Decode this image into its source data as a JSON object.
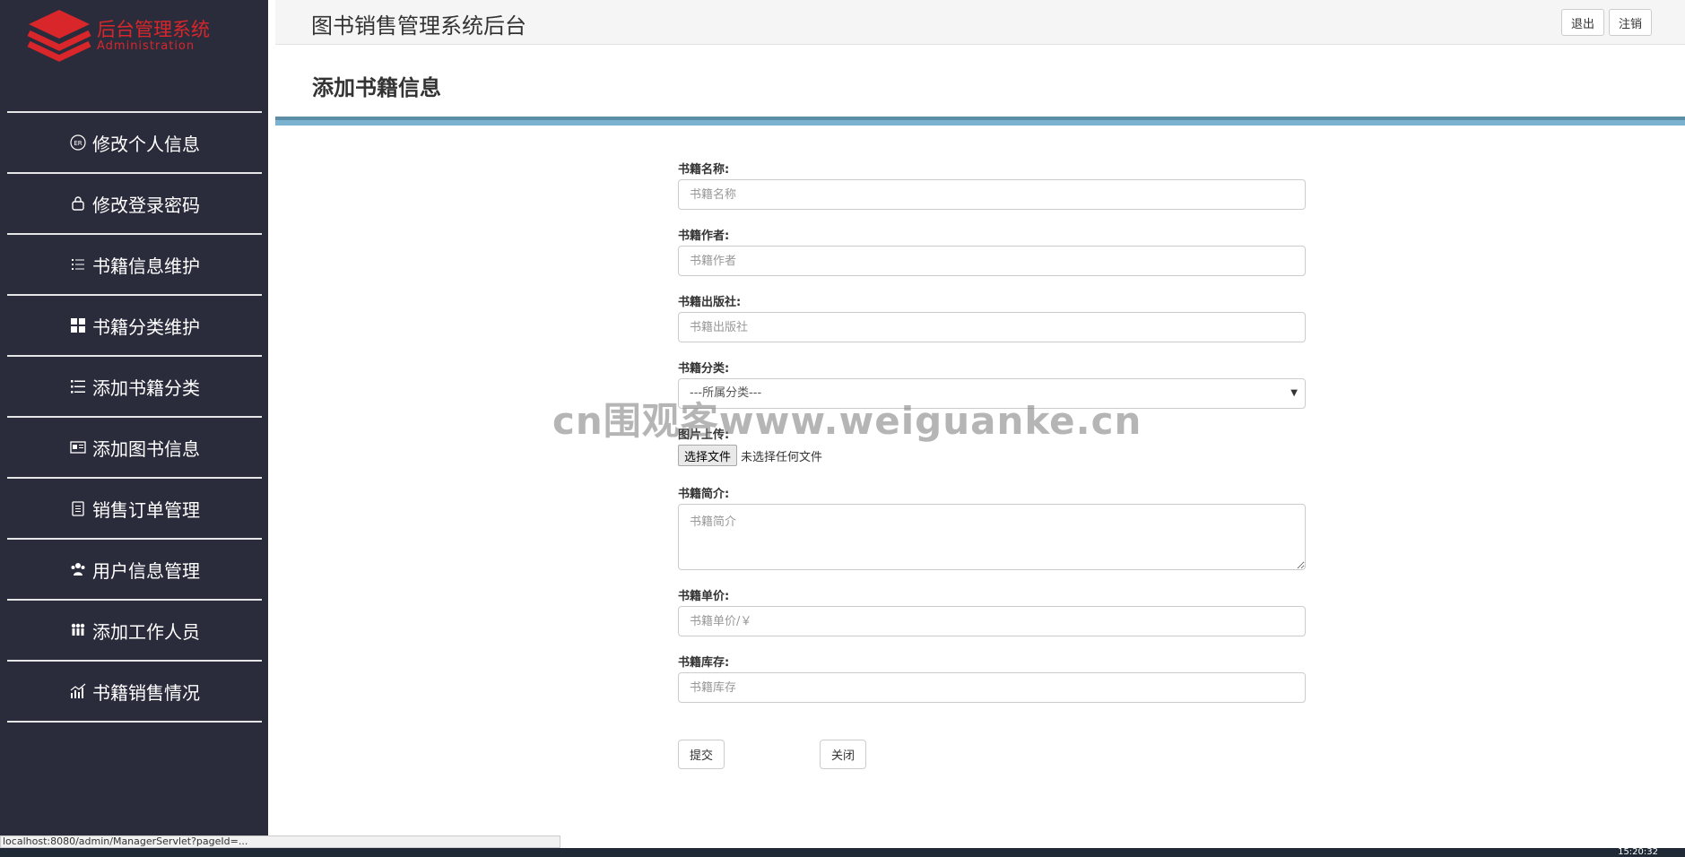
{
  "logo": {
    "title": "后台管理系统",
    "subtitle": "Administration"
  },
  "sidebar": {
    "items": [
      {
        "label": "修改个人信息",
        "icon": "id-card-icon"
      },
      {
        "label": "修改登录密码",
        "icon": "lock-icon"
      },
      {
        "label": "书籍信息维护",
        "icon": "list-icon"
      },
      {
        "label": "书籍分类维护",
        "icon": "grid-icon"
      },
      {
        "label": "添加书籍分类",
        "icon": "list-icon"
      },
      {
        "label": "添加图书信息",
        "icon": "book-icon"
      },
      {
        "label": "销售订单管理",
        "icon": "clipboard-icon"
      },
      {
        "label": "用户信息管理",
        "icon": "users-icon"
      },
      {
        "label": "添加工作人员",
        "icon": "group-icon"
      },
      {
        "label": "书籍销售情况",
        "icon": "chart-icon"
      }
    ]
  },
  "header": {
    "title": "图书销售管理系统后台",
    "logout_label": "退出",
    "cancel_label": "注销"
  },
  "page": {
    "title": "添加书籍信息"
  },
  "form": {
    "name": {
      "label": "书籍名称:",
      "placeholder": "书籍名称"
    },
    "author": {
      "label": "书籍作者:",
      "placeholder": "书籍作者"
    },
    "publisher": {
      "label": "书籍出版社:",
      "placeholder": "书籍出版社"
    },
    "category": {
      "label": "书籍分类:",
      "selected": "---所属分类---"
    },
    "image": {
      "label": "图片上传:",
      "button_label": "选择文件",
      "status": "未选择任何文件"
    },
    "intro": {
      "label": "书籍简介:",
      "placeholder": "书籍简介"
    },
    "price": {
      "label": "书籍单价:",
      "placeholder": "书籍单价/￥"
    },
    "stock": {
      "label": "书籍库存:",
      "placeholder": "书籍库存"
    },
    "submit_label": "提交",
    "close_label": "关闭"
  },
  "watermark": "cn围观客www.weiguanke.cn",
  "statusbar": {
    "url": "localhost:8080/admin/ManagerServlet?pageId=..."
  },
  "taskbar": {
    "time": "15:20:32"
  },
  "colors": {
    "sidebar": "#2b2c3b",
    "accent": "#d8262b",
    "bar": "#7ab2cf"
  }
}
